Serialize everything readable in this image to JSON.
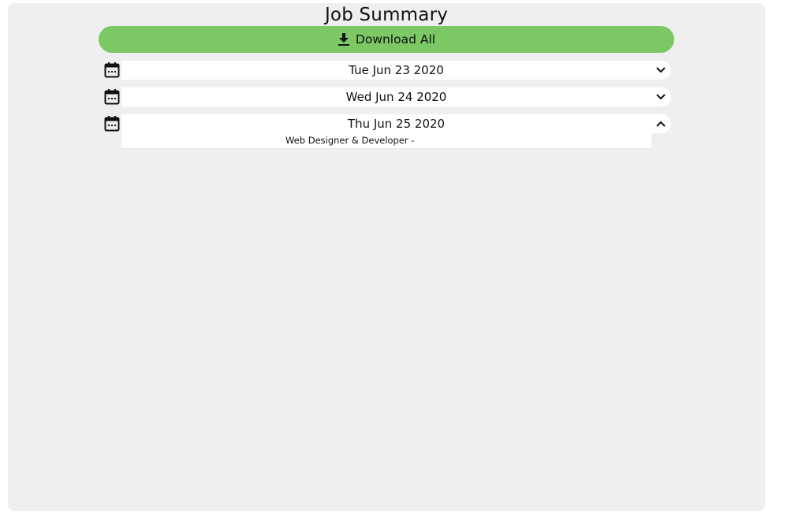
{
  "page": {
    "title": "Job Summary"
  },
  "download_all": {
    "label": "Download All",
    "icon": "download-icon",
    "color": "#7bc865"
  },
  "days": [
    {
      "date": "Tue Jun 23 2020",
      "expanded": false,
      "icon": "calendar-icon",
      "toggle_icon": "chevron-down-icon"
    },
    {
      "date": "Wed Jun 24 2020",
      "expanded": false,
      "icon": "calendar-icon",
      "toggle_icon": "chevron-down-icon"
    },
    {
      "date": "Thu Jun 25 2020",
      "expanded": true,
      "icon": "calendar-icon",
      "toggle_icon": "chevron-up-icon",
      "jobs": [
        {
          "text": "Web Designer & Developer -"
        }
      ]
    }
  ],
  "colors": {
    "panel_bg": "#efefef",
    "row_bg": "#ffffff",
    "accent": "#7bc865"
  }
}
